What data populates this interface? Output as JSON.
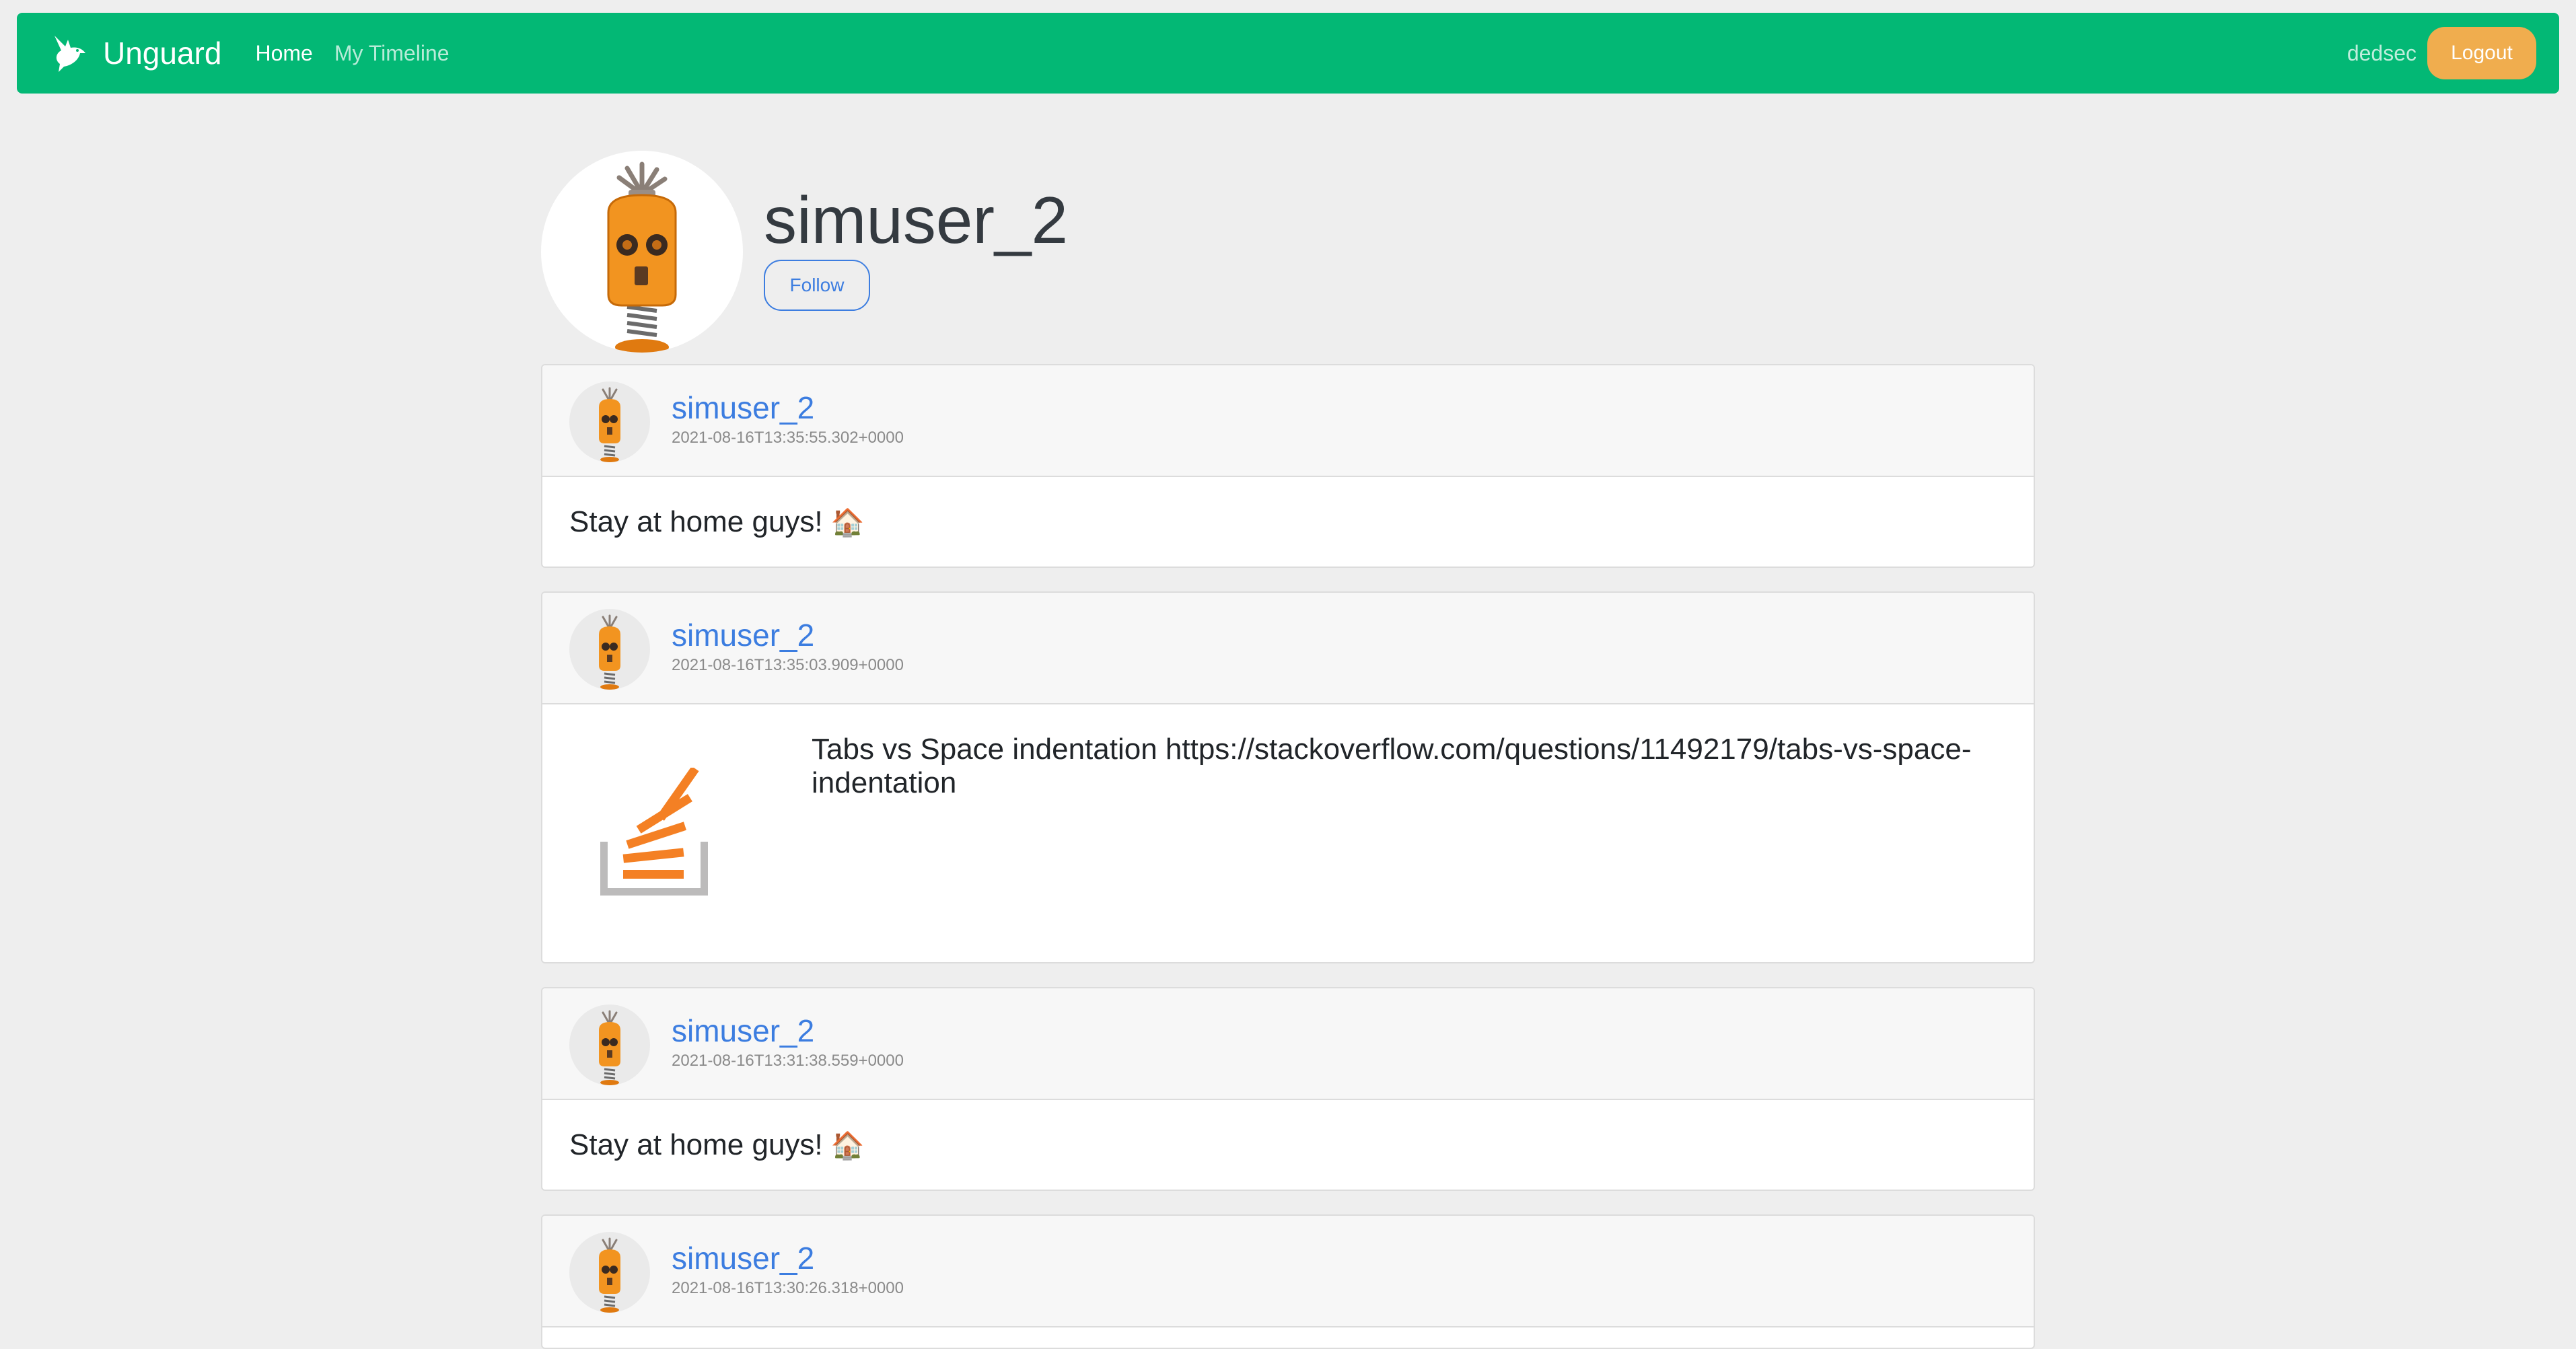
{
  "navbar": {
    "brand": "Unguard",
    "links": [
      {
        "label": "Home",
        "active": true
      },
      {
        "label": "My Timeline",
        "active": false
      }
    ],
    "username": "dedsec",
    "logout_label": "Logout"
  },
  "profile": {
    "username": "simuser_2",
    "follow_label": "Follow"
  },
  "posts": [
    {
      "author": "simuser_2",
      "timestamp": "2021-08-16T13:35:55.302+0000",
      "text": "Stay at home guys!",
      "emoji": "🏠"
    },
    {
      "author": "simuser_2",
      "timestamp": "2021-08-16T13:35:03.909+0000",
      "text": "Tabs vs Space indentation https://stackoverflow.com/questions/11492179/tabs-vs-space-indentation"
    },
    {
      "author": "simuser_2",
      "timestamp": "2021-08-16T13:31:38.559+0000",
      "text": "Stay at home guys!",
      "emoji": "🏠"
    },
    {
      "author": "simuser_2",
      "timestamp": "2021-08-16T13:30:26.318+0000"
    }
  ],
  "colors": {
    "navbar": "#03b875",
    "logout": "#f0ad4e",
    "link": "#3c7de0",
    "background": "#eeeeee"
  }
}
